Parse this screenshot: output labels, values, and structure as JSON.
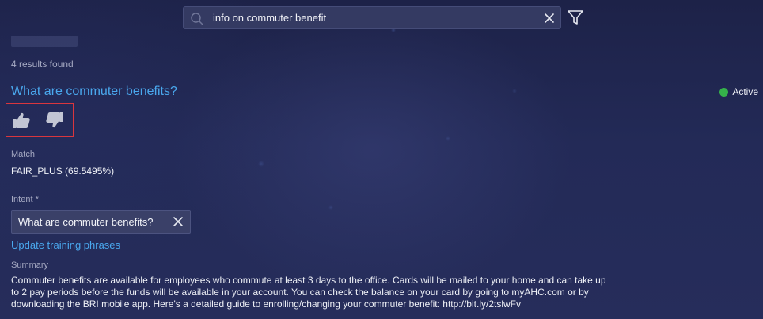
{
  "search": {
    "value": "info on commuter benefit",
    "icons": {
      "search": "search-icon",
      "clear": "close-icon",
      "filter": "filter-icon"
    }
  },
  "results": {
    "count_text": "4 results found"
  },
  "result": {
    "title": "What are commuter benefits?",
    "status_label": "Active",
    "status_color": "#35b24a",
    "match_label": "Match",
    "match_value": "FAIR_PLUS (69.5495%)",
    "intent_label": "Intent *",
    "intent_value": "What are commuter benefits?",
    "update_link": "Update training phrases",
    "summary_label": "Summary",
    "summary_text": "Commuter benefits are available for employees who commute at least 3 days to the office. Cards will be mailed to your home and can take up to 2 pay periods before the funds will be available in your account. You can check the balance on your card by going to myAHC.com or by downloading the BRI mobile app. Here's a detailed guide to enrolling/changing your commuter benefit: http://bit.ly/2tslwFv"
  },
  "feedback": {
    "icons": [
      "thumbs-up-icon",
      "thumbs-down-icon"
    ],
    "highlight_color": "#d9363e"
  },
  "colors": {
    "accent": "#4aa8ee",
    "background": "#232a57"
  }
}
